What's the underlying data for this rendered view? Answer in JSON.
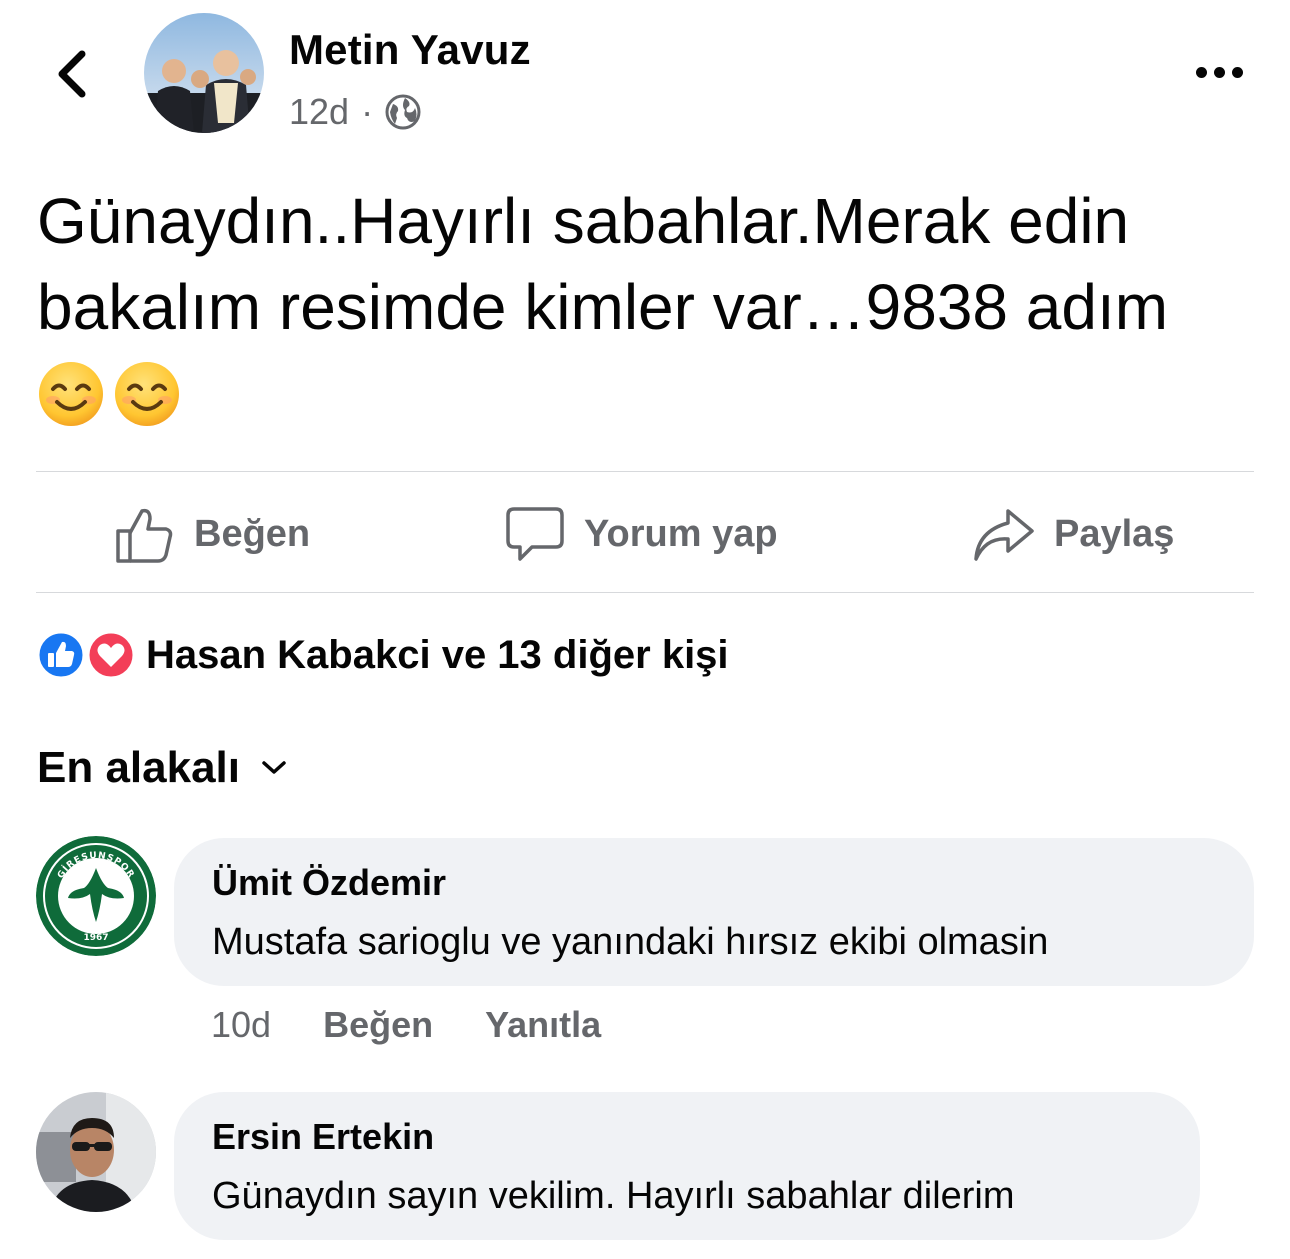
{
  "header": {
    "back_icon": "chevron-left-icon",
    "author_name": "Metin Yavuz",
    "time": "12d",
    "separator": "·",
    "audience_icon": "globe-icon",
    "more_icon": "more-horizontal-icon"
  },
  "post": {
    "text": "Günaydın..Hayırlı sabahlar.Merak edin\nbakalım resimde kimler var…9838 adım",
    "emoji": [
      "😊",
      "😊"
    ]
  },
  "actions": {
    "like_label": "Beğen",
    "comment_label": "Yorum yap",
    "share_label": "Paylaş",
    "like_icon": "thumbs-up-icon",
    "comment_icon": "speech-bubble-icon",
    "share_icon": "share-arrow-icon"
  },
  "reactions": {
    "summary": "Hasan Kabakci ve 13 diğer kişi",
    "icons": [
      "like-reaction-icon",
      "love-reaction-icon"
    ],
    "colors": {
      "like": "#1877f2",
      "love": "#f33e58"
    }
  },
  "sort": {
    "label": "En alakalı",
    "icon": "chevron-down-icon"
  },
  "comments": [
    {
      "author": "Ümit Özdemir",
      "text": "Mustafa sarioglu ve yanındaki hırsız ekibi olmasin",
      "time": "10d",
      "like_label": "Beğen",
      "reply_label": "Yanıtla",
      "avatar_badge": {
        "text": "GİRESUNSPOR",
        "year": "1967",
        "color": "#0f6b3a"
      }
    },
    {
      "author": "Ersin Ertekin",
      "text": "Günaydın sayın vekilim. Hayırlı sabahlar dilerim"
    }
  ]
}
